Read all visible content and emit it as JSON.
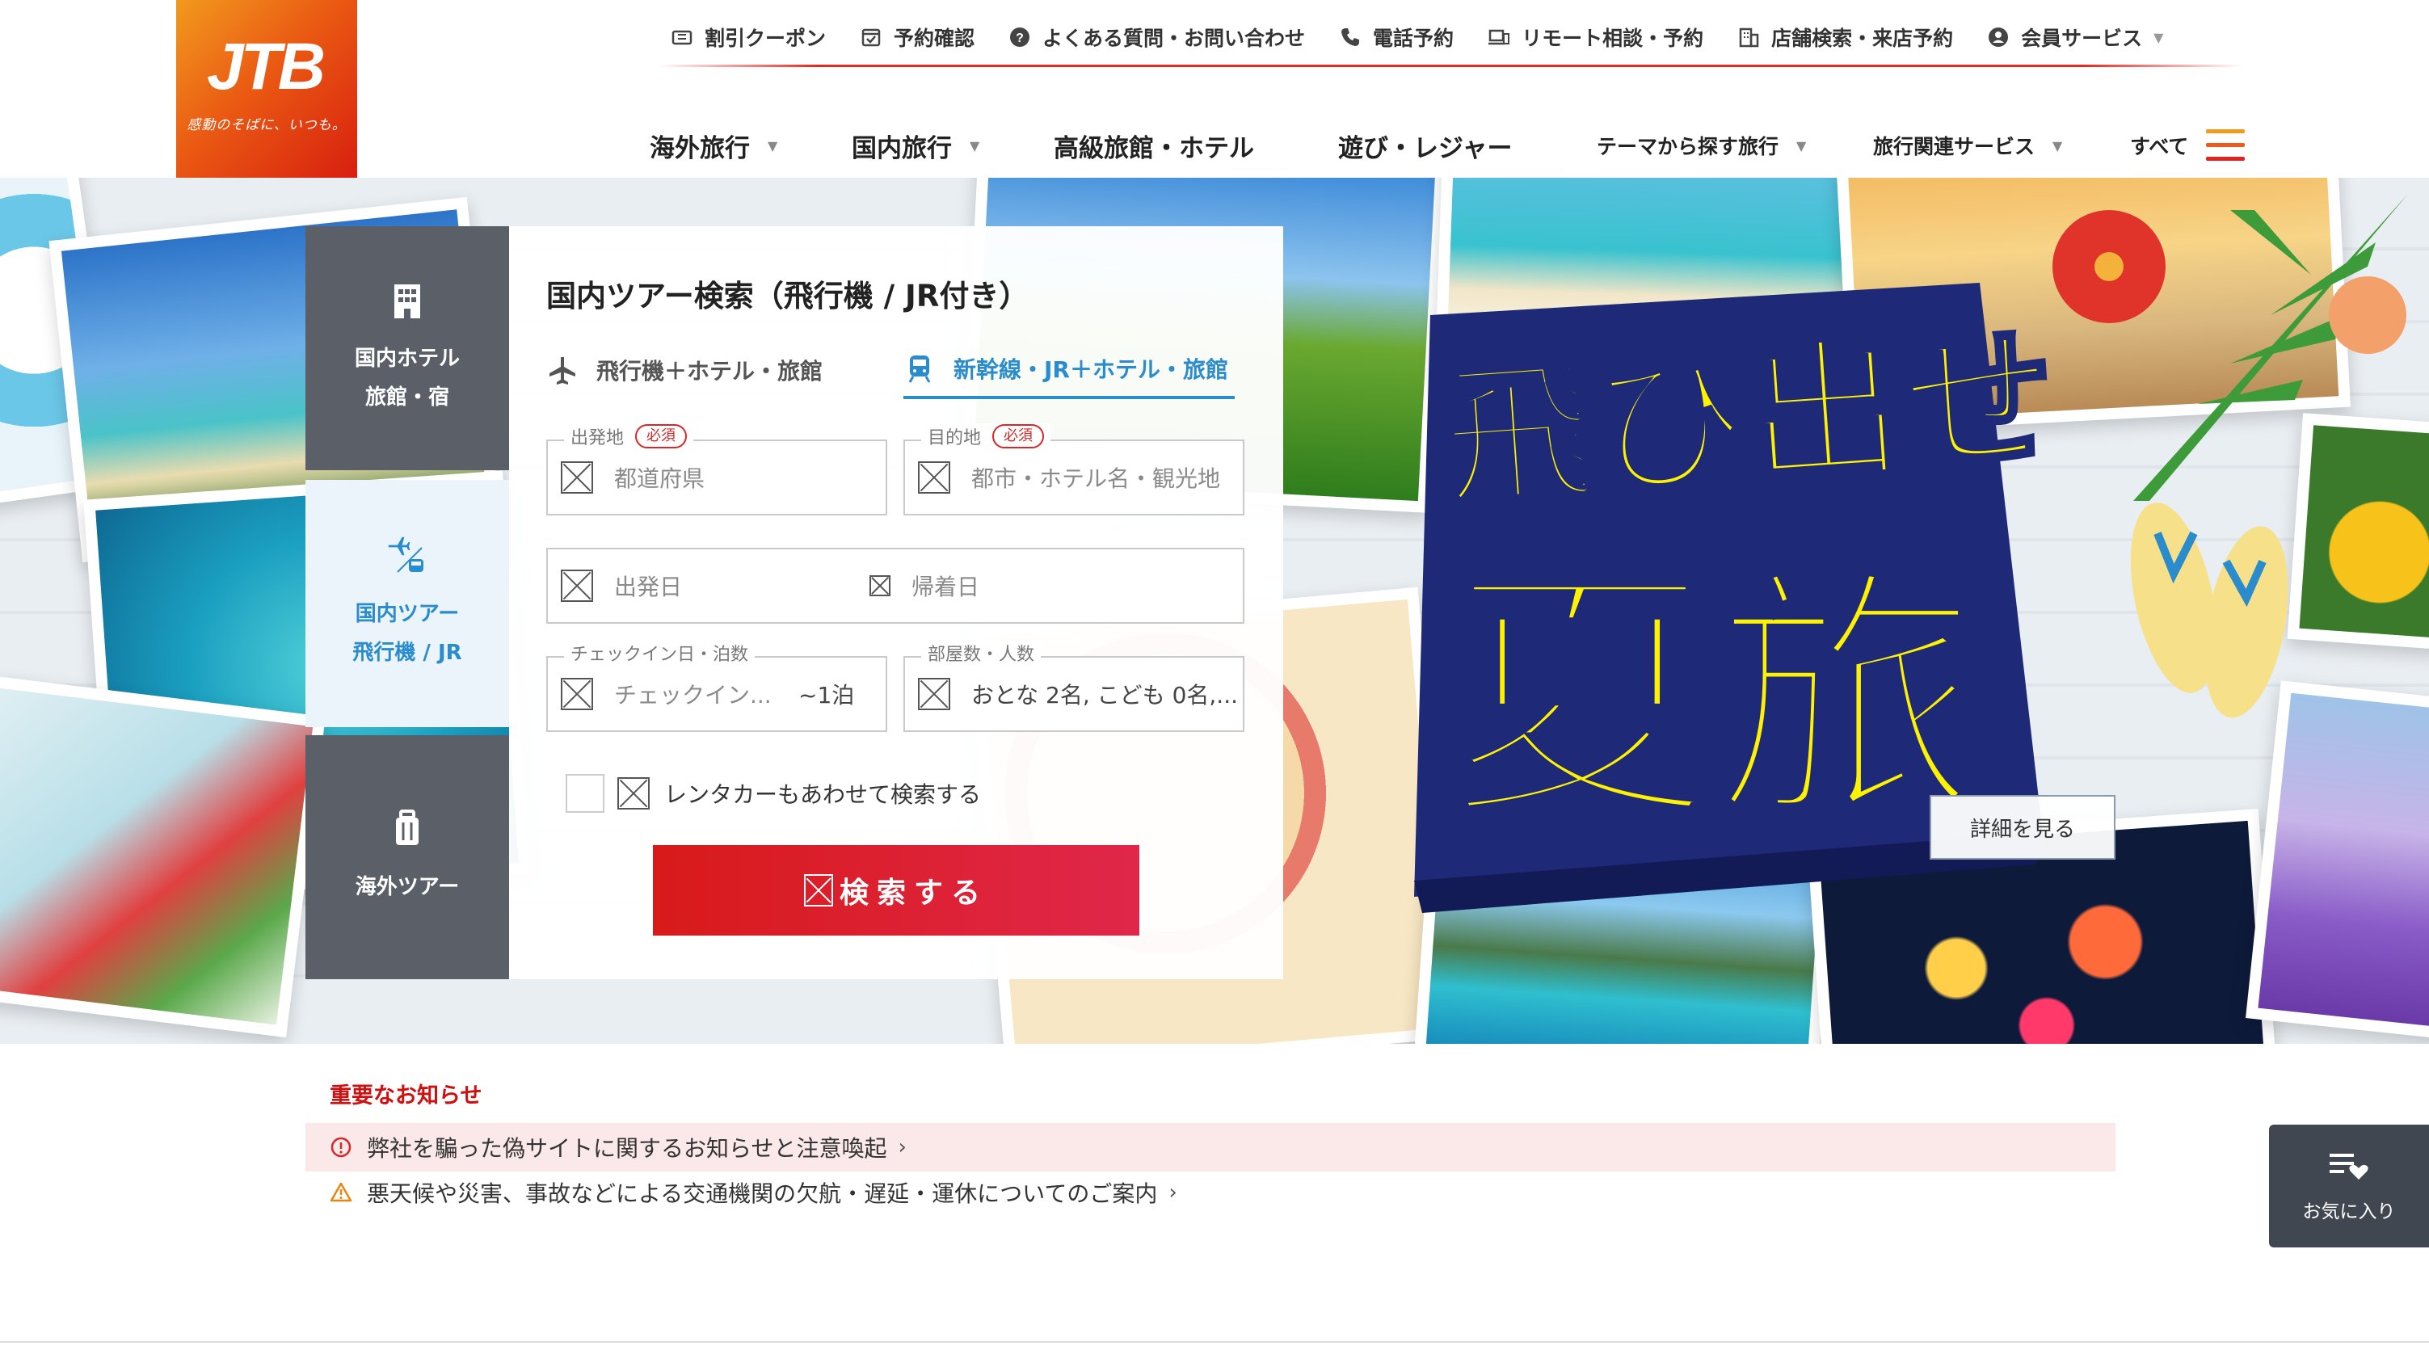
{
  "brand": {
    "logo_text": "JTB",
    "tagline": "感動のそばに、いつも。",
    "colors": {
      "orange": "#ea5a13",
      "red": "#e8281e",
      "blue": "#2a8ccc",
      "dark_tab": "#5b6068"
    }
  },
  "util_nav": {
    "items": [
      {
        "label": "割引クーポン",
        "icon": "coupon-icon"
      },
      {
        "label": "予約確認",
        "icon": "calendar-check-icon"
      },
      {
        "label": "よくある質問・お問い合わせ",
        "icon": "question-icon"
      },
      {
        "label": "電話予約",
        "icon": "phone-icon"
      },
      {
        "label": "リモート相談・予約",
        "icon": "laptop-icon"
      },
      {
        "label": "店舗検索・来店予約",
        "icon": "building-icon"
      },
      {
        "label": "会員サービス",
        "icon": "user-icon"
      }
    ]
  },
  "main_nav": {
    "items": [
      {
        "label": "海外旅行"
      },
      {
        "label": "国内旅行"
      },
      {
        "label": "高級旅館・ホテル"
      },
      {
        "label": "遊び・レジャー"
      },
      {
        "label": "テーマから探す旅行"
      },
      {
        "label": "旅行関連サービス"
      },
      {
        "label": "すべて"
      }
    ]
  },
  "side_tabs": [
    {
      "line1": "国内ホテル",
      "line2": "旅館・宿",
      "icon": "hotel-building-icon",
      "active": false
    },
    {
      "line1": "国内ツアー",
      "line2": "飛行機 / JR",
      "icon": "plane-train-icon",
      "active": true
    },
    {
      "line1": "海外ツアー",
      "line2": "",
      "icon": "suitcase-icon",
      "active": false
    }
  ],
  "search": {
    "title": "国内ツアー検索（飛行機 / JR付き）",
    "modes": [
      {
        "label": "飛行機＋ホテル・旅館",
        "icon": "airplane-icon"
      },
      {
        "label": "新幹線・JR＋ホテル・旅館",
        "icon": "train-icon"
      }
    ],
    "origin": {
      "label": "出発地",
      "required": "必須",
      "placeholder": "都道府県"
    },
    "destination": {
      "label": "目的地",
      "required": "必須",
      "placeholder": "都市・ホテル名・観光地"
    },
    "depart_date": {
      "placeholder": "出発日"
    },
    "return_date": {
      "placeholder": "帰着日"
    },
    "checkin": {
      "label": "チェックイン日・泊数",
      "placeholder": "チェックイン...",
      "nights": "~1泊"
    },
    "rooms": {
      "label": "部屋数・人数",
      "value": "おとな 2名, こども 0名,..."
    },
    "rental_car": "レンタカーもあわせて検索する",
    "submit": "検索する"
  },
  "hero": {
    "headline_line1": "飛び出せ!",
    "headline_line2": "夏旅",
    "detail_button": "詳細を見る"
  },
  "notices": {
    "title": "重要なお知らせ",
    "items": [
      {
        "text": "弊社を騙った偽サイトに関するお知らせと注意喚起",
        "icon": "alert-circle-icon"
      },
      {
        "text": "悪天候や災害、事故などによる交通機関の欠航・遅延・運休についてのご案内",
        "icon": "warning-triangle-icon"
      }
    ]
  },
  "favorites": {
    "label": "お気に入り",
    "icon": "list-heart-icon"
  }
}
